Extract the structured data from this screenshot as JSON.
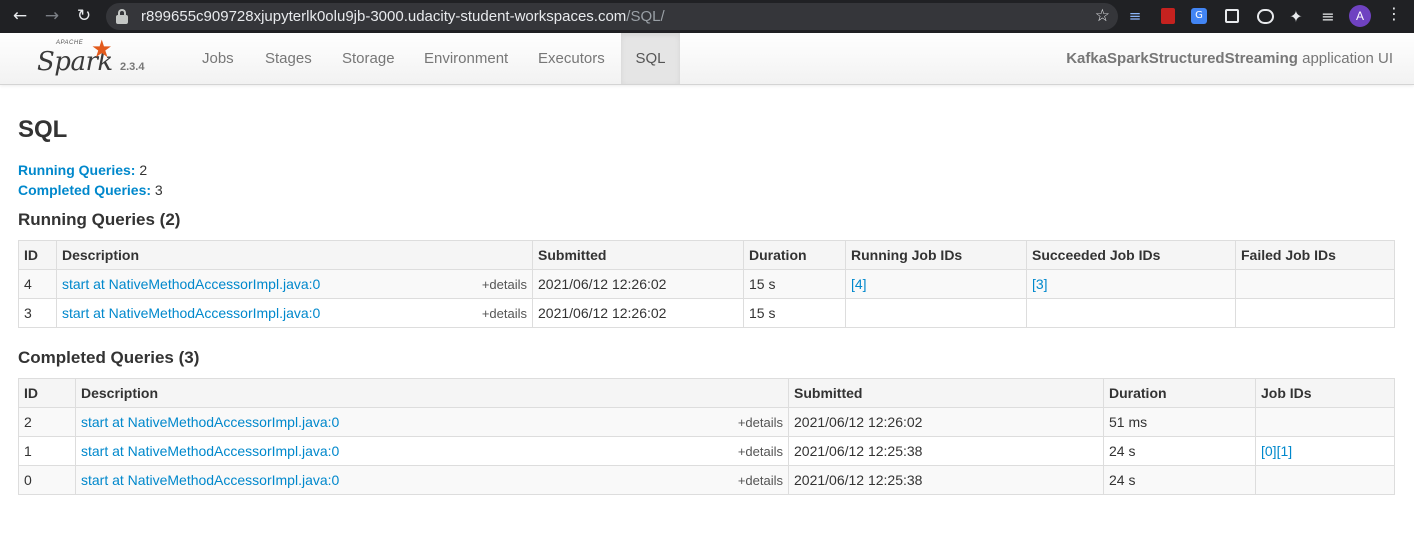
{
  "browser": {
    "url_host": "r899655c909728xjupyterlk0olu9jb-3000.udacity-student-workspaces.com",
    "url_path": "/SQL/",
    "avatar_letter": "A",
    "ext_3_label": "G"
  },
  "navbar": {
    "logo_apache": "APACHE",
    "logo_word": "Spark",
    "version": "2.3.4",
    "tabs": {
      "jobs": "Jobs",
      "stages": "Stages",
      "storage": "Storage",
      "environment": "Environment",
      "executors": "Executors",
      "sql": "SQL"
    },
    "app_name": "KafkaSparkStructuredStreaming",
    "app_suffix": " application UI"
  },
  "page": {
    "title": "SQL",
    "running_label": "Running Queries:",
    "running_count": "2",
    "completed_label": "Completed Queries:",
    "completed_count": "3"
  },
  "running": {
    "title": "Running Queries (2)",
    "headers": [
      "ID",
      "Description",
      "Submitted",
      "Duration",
      "Running Job IDs",
      "Succeeded Job IDs",
      "Failed Job IDs"
    ],
    "rows": [
      {
        "id": "4",
        "description": "start at NativeMethodAccessorImpl.java:0",
        "details": "+details",
        "submitted": "2021/06/12 12:26:02",
        "duration": "15 s",
        "running_jobs": "[4]",
        "succeeded_jobs": "[3]",
        "failed_jobs": ""
      },
      {
        "id": "3",
        "description": "start at NativeMethodAccessorImpl.java:0",
        "details": "+details",
        "submitted": "2021/06/12 12:26:02",
        "duration": "15 s",
        "running_jobs": "",
        "succeeded_jobs": "",
        "failed_jobs": ""
      }
    ]
  },
  "completed": {
    "title": "Completed Queries (3)",
    "headers": [
      "ID",
      "Description",
      "Submitted",
      "Duration",
      "Job IDs"
    ],
    "rows": [
      {
        "id": "2",
        "description": "start at NativeMethodAccessorImpl.java:0",
        "details": "+details",
        "submitted": "2021/06/12 12:26:02",
        "duration": "51 ms",
        "job_ids": ""
      },
      {
        "id": "1",
        "description": "start at NativeMethodAccessorImpl.java:0",
        "details": "+details",
        "submitted": "2021/06/12 12:25:38",
        "duration": "24 s",
        "job_ids": "[0][1]"
      },
      {
        "id": "0",
        "description": "start at NativeMethodAccessorImpl.java:0",
        "details": "+details",
        "submitted": "2021/06/12 12:25:38",
        "duration": "24 s",
        "job_ids": ""
      }
    ]
  }
}
